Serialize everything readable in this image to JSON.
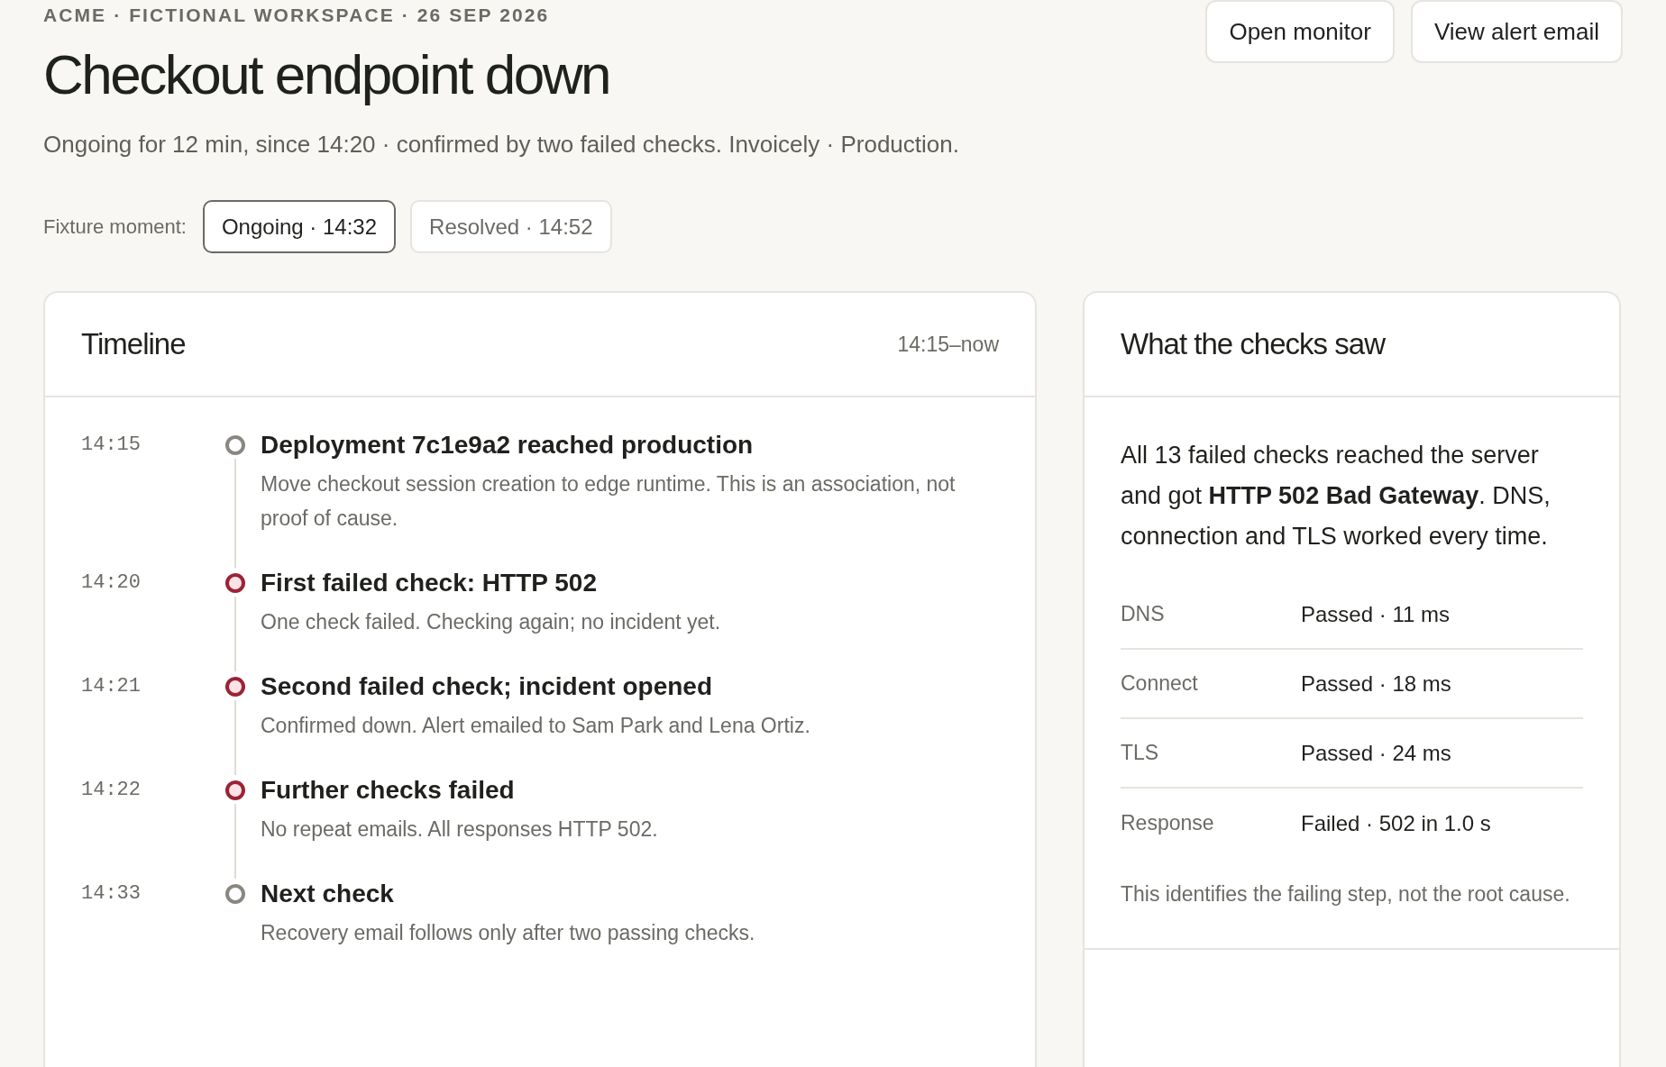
{
  "header": {
    "eyebrow": "ACME · FICTIONAL WORKSPACE · 26 SEP 2026",
    "title": "Checkout endpoint down",
    "subtitle": "Ongoing for 12 min, since 14:20 · confirmed by two failed checks. Invoicely · Production.",
    "actions": [
      "Open monitor",
      "View alert email"
    ]
  },
  "fixture": {
    "label": "Fixture moment:",
    "options": [
      {
        "label": "Ongoing · 14:32",
        "selected": true
      },
      {
        "label": "Resolved · 14:52",
        "selected": false
      }
    ]
  },
  "timeline": {
    "title": "Timeline",
    "range": "14:15–now",
    "events": [
      {
        "time": "14:15",
        "kind": "neutral",
        "title": "Deployment 7c1e9a2 reached production",
        "detail": "Move checkout session creation to edge runtime. This is an association, not proof of cause."
      },
      {
        "time": "14:20",
        "kind": "failed",
        "title": "First failed check: HTTP 502",
        "detail": "One check failed. Checking again; no incident yet."
      },
      {
        "time": "14:21",
        "kind": "failed",
        "title": "Second failed check; incident opened",
        "detail": "Confirmed down. Alert emailed to Sam Park and Lena Ortiz."
      },
      {
        "time": "14:22",
        "kind": "failed",
        "title": "Further checks failed",
        "detail": "No repeat emails. All responses HTTP 502."
      },
      {
        "time": "14:33",
        "kind": "neutral",
        "title": "Next check",
        "detail": "Recovery email follows only after two passing checks."
      }
    ]
  },
  "checks": {
    "title": "What the checks saw",
    "summary": "All 13 failed checks reached the server and got **HTTP 502 Bad Gateway**. DNS, connection and TLS worked every time.",
    "steps": [
      {
        "step": "DNS",
        "result": "Passed · 11 ms"
      },
      {
        "step": "Connect",
        "result": "Passed · 18 ms"
      },
      {
        "step": "TLS",
        "result": "Passed · 24 ms"
      },
      {
        "step": "Response",
        "result": "Failed · 502 in 1.0 s"
      }
    ],
    "note": "This identifies the failing step, not the root cause."
  }
}
